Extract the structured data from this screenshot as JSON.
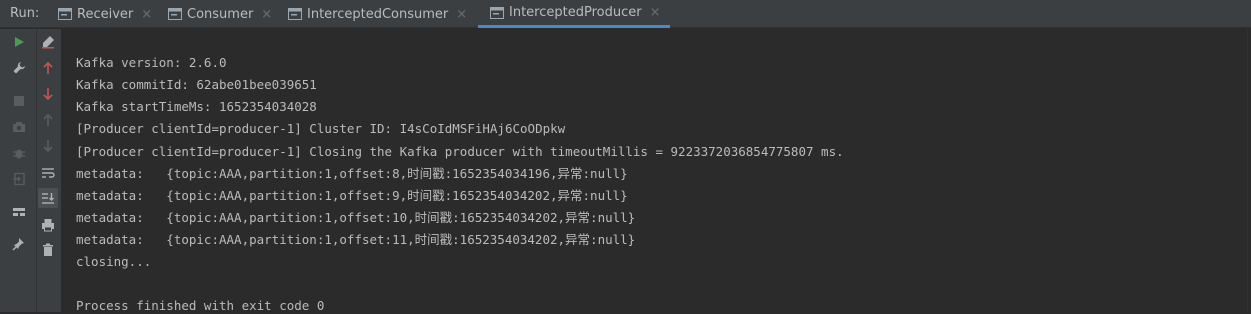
{
  "run_label": "Run:",
  "tabs": [
    {
      "label": "Receiver",
      "active": false
    },
    {
      "label": "Consumer",
      "active": false
    },
    {
      "label": "InterceptedConsumer",
      "active": false
    },
    {
      "label": "InterceptedProducer",
      "active": true
    }
  ],
  "tab_close_glyph": "×",
  "toolbar_icons": [
    "rerun-icon",
    "wrench-icon",
    "stop-icon",
    "camera-icon",
    "bug-icon",
    "exit-icon",
    "layout-icon",
    "pin-icon",
    "clear-icon",
    "up-arrow-icon",
    "down-arrow-icon",
    "up-gray-icon",
    "down-gray-icon",
    "soft-wrap-icon",
    "scroll-to-end-icon",
    "print-icon",
    "trash-icon"
  ],
  "colors": {
    "background": "#2b2b2b",
    "panel": "#3c3f41",
    "accent": "#4a88c7",
    "run_green": "#499c54",
    "arrow_red": "#c75450",
    "text": "#bbbbbb"
  },
  "console": {
    "lines": [
      "Kafka version: 2.6.0",
      "Kafka commitId: 62abe01bee039651",
      "Kafka startTimeMs: 1652354034028",
      "[Producer clientId=producer-1] Cluster ID: I4sCoIdMSFiHAj6CoODpkw",
      "[Producer clientId=producer-1] Closing the Kafka producer with timeoutMillis = 9223372036854775807 ms.",
      "metadata:   {topic:AAA,partition:1,offset:8,时间戳:1652354034196,异常:null}",
      "metadata:   {topic:AAA,partition:1,offset:9,时间戳:1652354034202,异常:null}",
      "metadata:   {topic:AAA,partition:1,offset:10,时间戳:1652354034202,异常:null}",
      "metadata:   {topic:AAA,partition:1,offset:11,时间戳:1652354034202,异常:null}",
      "closing...",
      "",
      "Process finished with exit code 0"
    ]
  }
}
